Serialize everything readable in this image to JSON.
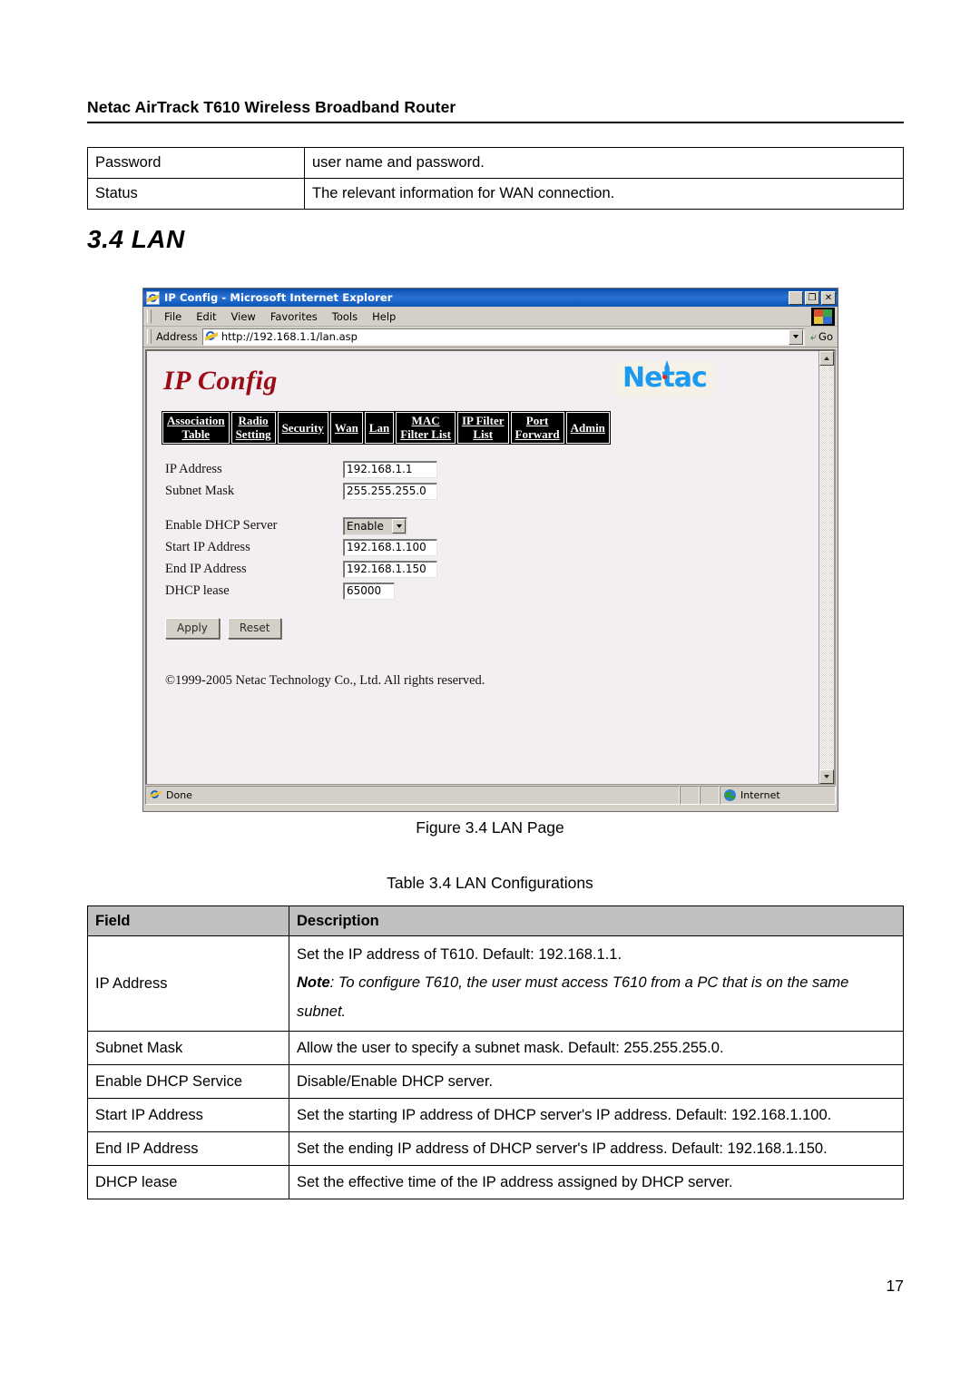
{
  "document": {
    "running_header": "Netac AirTrack T610 Wireless Broadband Router",
    "section_heading": "3.4 LAN",
    "figure_caption": "Figure 3.4 LAN Page",
    "table_caption": "Table 3.4 LAN Configurations",
    "page_number": "17"
  },
  "top_table": {
    "rows": [
      {
        "field": "Password",
        "description": "user name and password."
      },
      {
        "field": "Status",
        "description": "The relevant information for WAN connection."
      }
    ]
  },
  "browser": {
    "title": "IP Config - Microsoft Internet Explorer",
    "window_buttons": {
      "minimize": "_",
      "restore": "❐",
      "close": "✕"
    },
    "menu_items": [
      "File",
      "Edit",
      "View",
      "Favorites",
      "Tools",
      "Help"
    ],
    "address": {
      "label": "Address",
      "url": "http://192.168.1.1/lan.asp",
      "go_label": "Go"
    },
    "status": {
      "left": "Done",
      "zone": "Internet"
    }
  },
  "webpage": {
    "logo_text": "IP Config",
    "brand_text": "Netac",
    "tabs": [
      {
        "line1": "Association",
        "line2": "Table"
      },
      {
        "line1": "Radio",
        "line2": "Setting"
      },
      {
        "line1": "Security",
        "line2": ""
      },
      {
        "line1": "Wan",
        "line2": ""
      },
      {
        "line1": "Lan",
        "line2": ""
      },
      {
        "line1": "MAC",
        "line2": "Filter List"
      },
      {
        "line1": "IP Filter",
        "line2": "List"
      },
      {
        "line1": "Port",
        "line2": "Forward"
      },
      {
        "line1": "Admin",
        "line2": ""
      }
    ],
    "form": {
      "ip_address_label": "IP Address",
      "ip_address_value": "192.168.1.1",
      "subnet_mask_label": "Subnet Mask",
      "subnet_mask_value": "255.255.255.0",
      "enable_dhcp_label": "Enable DHCP Server",
      "enable_dhcp_value": "Enable",
      "start_ip_label": "Start IP Address",
      "start_ip_value": "192.168.1.100",
      "end_ip_label": "End IP Address",
      "end_ip_value": "192.168.1.150",
      "dhcp_lease_label": "DHCP lease",
      "dhcp_lease_value": "65000",
      "apply_button": "Apply",
      "reset_button": "Reset"
    },
    "copyright": "©1999-2005 Netac Technology Co., Ltd. All rights reserved."
  },
  "config_table": {
    "headers": {
      "field": "Field",
      "description": "Description"
    },
    "ip_address": {
      "field": "IP Address",
      "desc_line1": "Set the IP address of T610. Default: 192.168.1.1.",
      "note_label": "Note",
      "note_text": ": To configure T610, the user must access T610 from a PC that is on the same subnet."
    },
    "rows": [
      {
        "field": "Subnet Mask",
        "description": "Allow the user to specify a subnet mask. Default: 255.255.255.0."
      },
      {
        "field": "Enable DHCP Service",
        "description": "Disable/Enable DHCP server."
      },
      {
        "field": "Start IP Address",
        "description": "Set the starting IP address of DHCP server's IP address. Default: 192.168.1.100."
      },
      {
        "field": "End IP Address",
        "description": "Set the ending IP address of DHCP server's IP address. Default: 192.168.1.150."
      },
      {
        "field": "DHCP lease",
        "description": "Set the effective time of the IP address assigned by DHCP server."
      }
    ]
  }
}
